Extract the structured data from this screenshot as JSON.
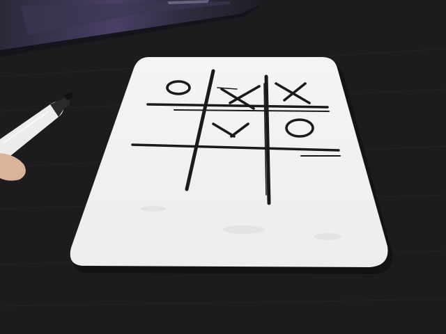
{
  "scene": {
    "description_free": true,
    "colors": {
      "desk": "#1c1b1d",
      "desk_grain": "#26252a",
      "laptop": "#2e2d3d",
      "laptop_edge": "#3e3c55",
      "laptop_glow": "#6a5a8a",
      "card": "#f2f2f0",
      "card_shadow": "#0f0f10",
      "ink": "#1a1a1a",
      "marker_body": "#ececec",
      "marker_tip": "#111111",
      "skin": "#d9b49a"
    }
  },
  "board": {
    "cells": [
      [
        "O",
        "X",
        "X"
      ],
      [
        "",
        "X",
        "O"
      ],
      [
        "",
        "",
        ""
      ]
    ]
  }
}
